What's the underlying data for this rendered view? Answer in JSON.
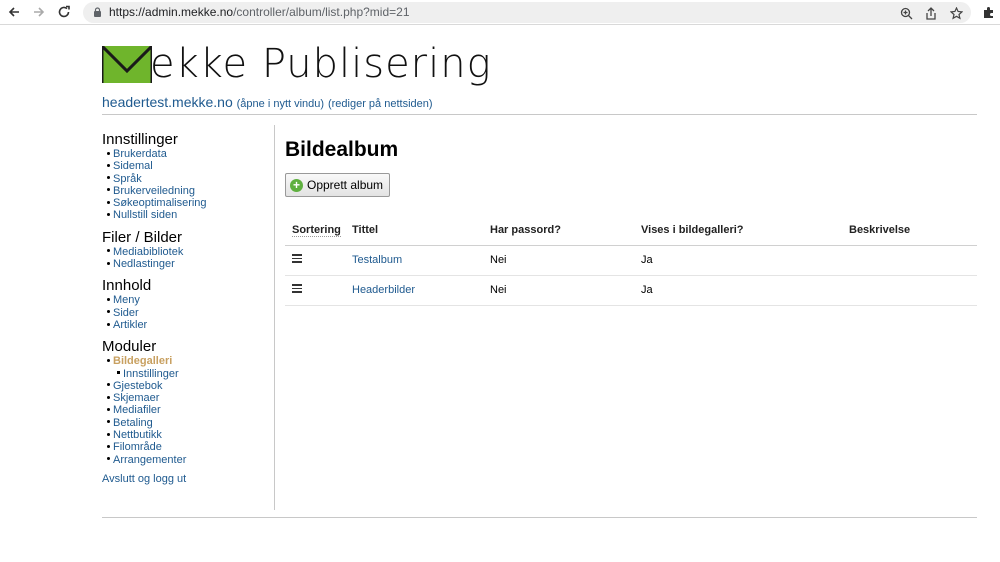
{
  "browser": {
    "url_host": "https://admin.mekke.no",
    "url_path": "/controller/album/list.php?mid=21"
  },
  "header": {
    "logo_text": "ekke Publisering",
    "site_host": "headertest.mekke.no",
    "open_new_window": "(åpne i nytt vindu)",
    "edit_on_site": "(rediger på nettsiden)"
  },
  "sidebar": {
    "groups": [
      {
        "title": "Innstillinger",
        "items": [
          "Brukerdata",
          "Sidemal",
          "Språk",
          "Brukerveiledning",
          "Søkeoptimalisering",
          "Nullstill siden"
        ]
      },
      {
        "title": "Filer / Bilder",
        "items": [
          "Mediabibliotek",
          "Nedlastinger"
        ]
      },
      {
        "title": "Innhold",
        "items": [
          "Meny",
          "Sider",
          "Artikler"
        ]
      },
      {
        "title": "Moduler",
        "items": [
          "Bildegalleri",
          "Innstillinger",
          "Gjestebok",
          "Skjemaer",
          "Mediafiler",
          "Betaling",
          "Nettbutikk",
          "Filområde",
          "Arrangementer"
        ]
      }
    ],
    "logout": "Avslutt og logg ut"
  },
  "main": {
    "title": "Bildealbum",
    "create_button": "Opprett album",
    "columns": [
      "Sortering",
      "Tittel",
      "Har passord?",
      "Vises i bildegalleri?",
      "Beskrivelse"
    ],
    "rows": [
      {
        "title": "Testalbum",
        "password": "Nei",
        "shown": "Ja",
        "description": ""
      },
      {
        "title": "Headerbilder",
        "password": "Nei",
        "shown": "Ja",
        "description": ""
      }
    ]
  },
  "colors": {
    "link": "#1f5a8f",
    "active": "#c8a060",
    "logo_green": "#6fb52c"
  }
}
